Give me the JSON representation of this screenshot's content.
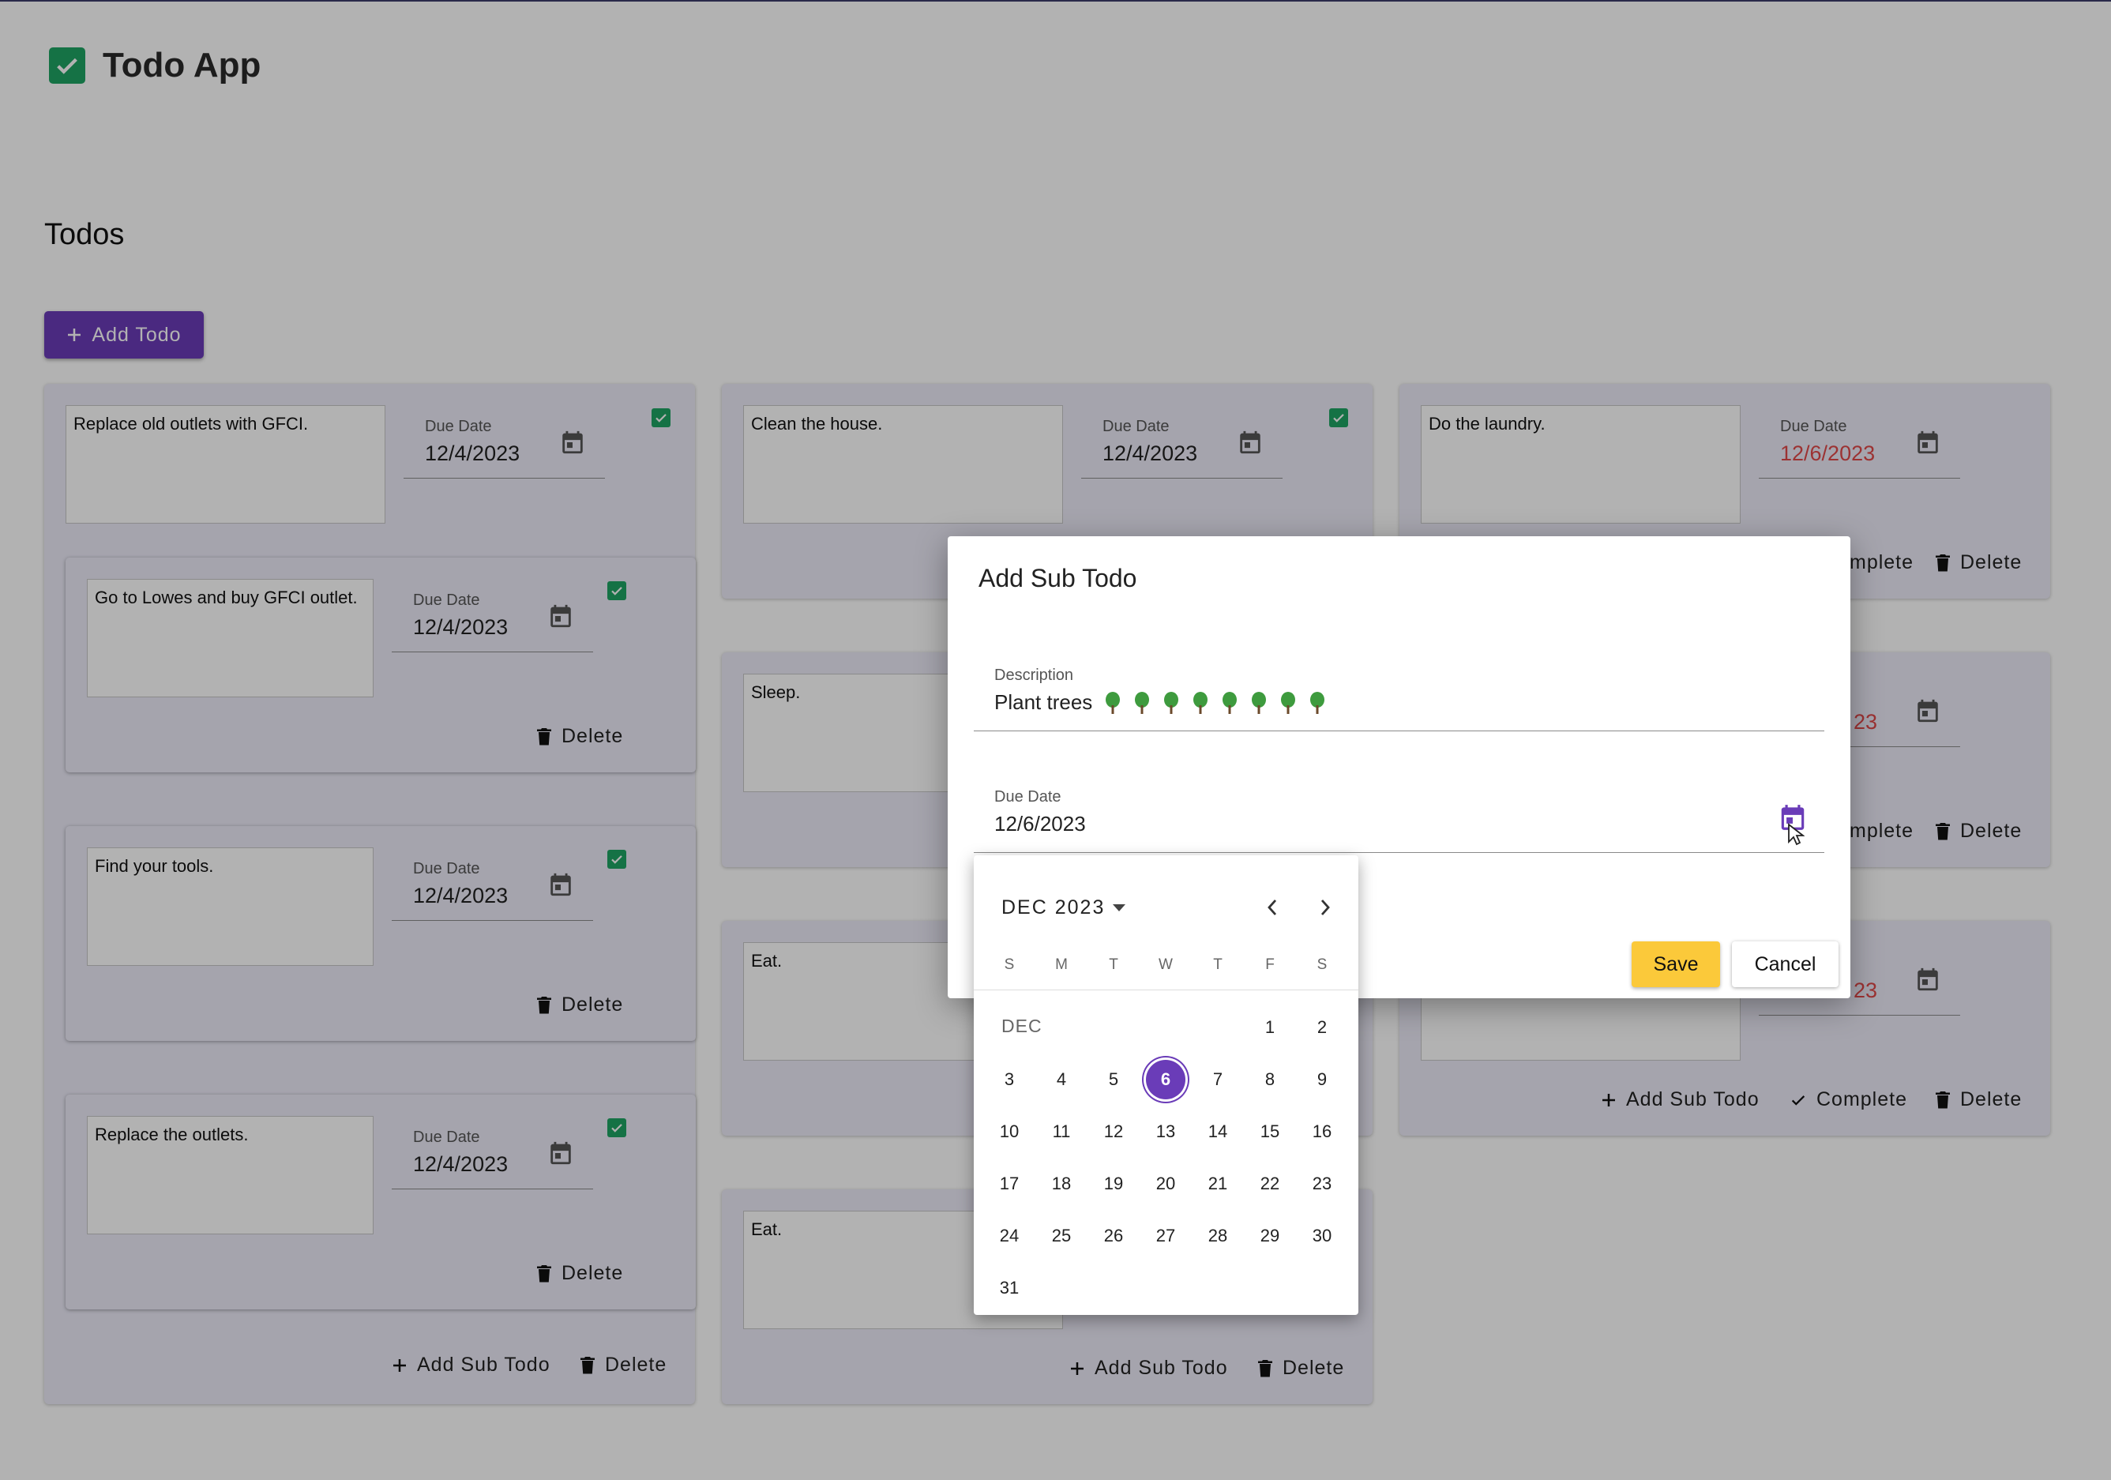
{
  "app": {
    "title": "Todo App"
  },
  "page": {
    "section_title": "Todos",
    "add_todo_label": "Add Todo"
  },
  "common": {
    "due_label": "Due Date",
    "delete_label": "Delete",
    "add_sub_todo_label": "Add Sub Todo",
    "complete_label": "Complete"
  },
  "columns": {
    "c1": {
      "description": "Replace old outlets with GFCI.",
      "due": "12/4/2023",
      "subtodos": [
        {
          "description": "Go to Lowes and buy GFCI outlet.",
          "due": "12/4/2023"
        },
        {
          "description": "Find your tools.",
          "due": "12/4/2023"
        },
        {
          "description": "Replace the outlets.",
          "due": "12/4/2023"
        }
      ]
    },
    "c2": {
      "description": "Clean the house.",
      "due": "12/4/2023",
      "subtodos": [
        {
          "description": "Sleep."
        },
        {
          "description": "Eat."
        },
        {
          "description": "Eat."
        }
      ]
    },
    "c3": {
      "description": "Do the laundry.",
      "due": "12/6/2023",
      "sub_due_partial": "23",
      "complete_partial": "mplete"
    }
  },
  "dialog": {
    "title": "Add Sub Todo",
    "description_label": "Description",
    "description_value": "Plant trees",
    "description_emoji": "tree-icon",
    "description_emoji_count": 8,
    "due_label": "Due Date",
    "due_value": "12/6/2023",
    "save_label": "Save",
    "cancel_label": "Cancel"
  },
  "picker": {
    "month_year": "DEC 2023",
    "month_tag": "DEC",
    "weekdays": [
      "S",
      "M",
      "T",
      "W",
      "T",
      "F",
      "S"
    ],
    "first_weekday_index": 5,
    "days_in_month": 31,
    "selected_day": 6
  },
  "colors": {
    "primary": "#6a3cb8",
    "check": "#1fa463",
    "overdue": "#e04848",
    "save": "#fbc93a",
    "tree": "#3e9b3e"
  }
}
